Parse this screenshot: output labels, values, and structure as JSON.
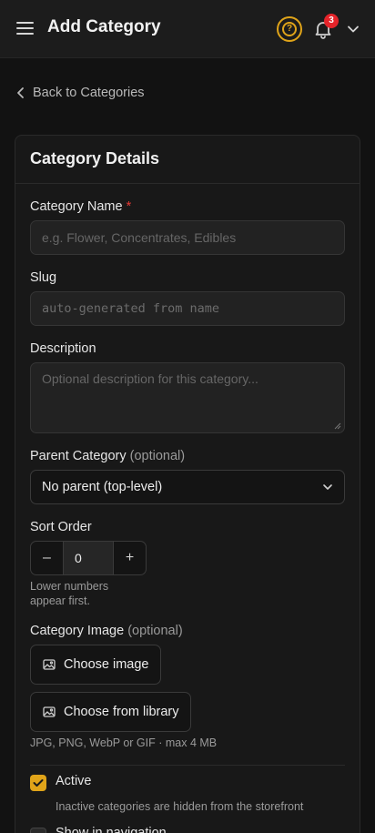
{
  "header": {
    "title": "Add Category",
    "notification_count": "3",
    "icons": [
      "menu-icon",
      "help-icon",
      "bell-icon",
      "chevron-down-icon"
    ],
    "accent_color": "#e0a419",
    "badge_color": "#e5242a"
  },
  "back_link": {
    "label": "Back to Categories"
  },
  "card": {
    "title": "Category Details",
    "fields": {
      "name": {
        "label": "Category Name",
        "required_mark": "*",
        "placeholder": "e.g. Flower, Concentrates, Edibles",
        "value": ""
      },
      "slug": {
        "label": "Slug",
        "placeholder": "auto-generated from name",
        "value": ""
      },
      "description": {
        "label": "Description",
        "placeholder": "Optional description for this category...",
        "value": ""
      },
      "parent": {
        "label": "Parent Category",
        "optional": "(optional)",
        "selected": "No parent (top-level)"
      },
      "sort_order": {
        "label": "Sort Order",
        "value": "0",
        "decrement": "–",
        "increment": "+",
        "help_line1": "Lower numbers",
        "help_line2": "appear first."
      },
      "image": {
        "label": "Category Image",
        "optional": "(optional)",
        "choose_image": "Choose image",
        "choose_library": "Choose from library",
        "help": "JPG, PNG, WebP or GIF · max 4 MB"
      }
    },
    "toggles": {
      "active": {
        "label": "Active",
        "checked": true,
        "help": "Inactive categories are hidden from the storefront"
      },
      "nav": {
        "label": "Show in navigation",
        "checked": false
      }
    }
  }
}
